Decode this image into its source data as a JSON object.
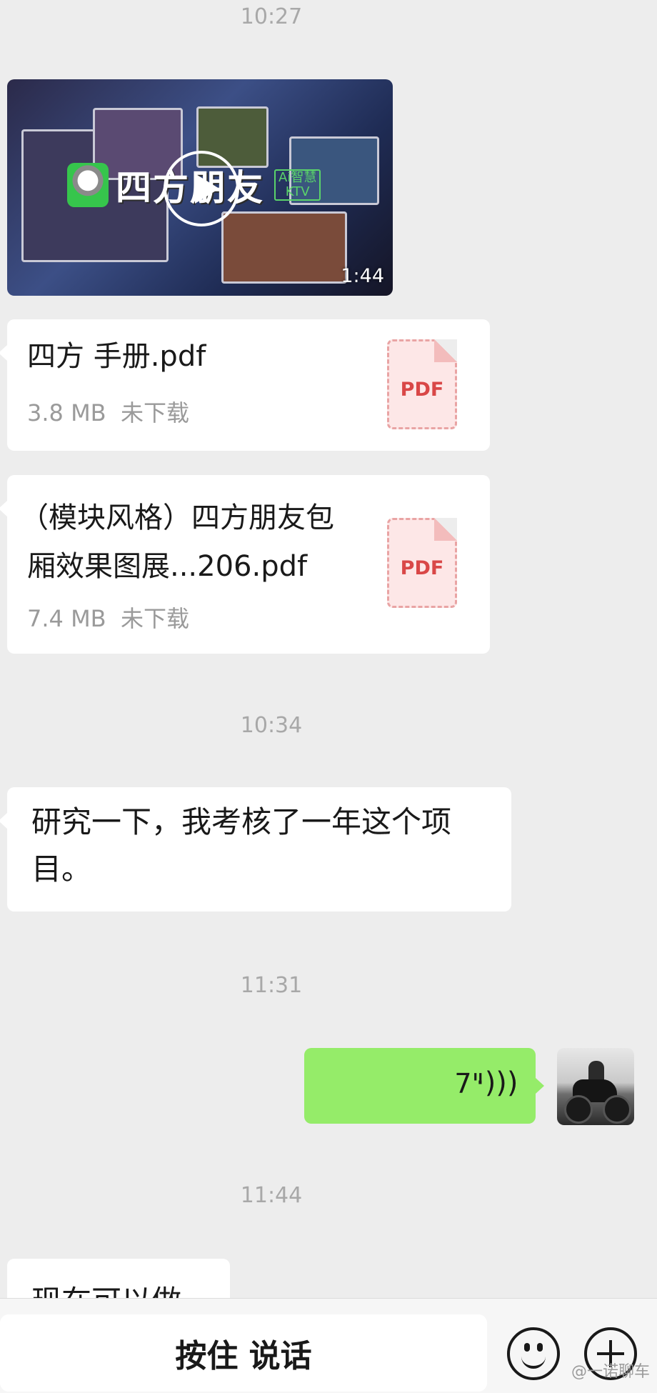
{
  "timestamps": [
    "10:27",
    "10:34",
    "11:31",
    "11:44"
  ],
  "video": {
    "brand_text": "四方朋友",
    "badge_top": "Ai智慧",
    "badge_bottom": "KTV",
    "duration": "1:44"
  },
  "files": [
    {
      "name": "四方 手册.pdf",
      "size": "3.8 MB",
      "status": "未下载",
      "type_label": "PDF"
    },
    {
      "name_line1": "（模块风格）四方朋友包",
      "name_line2": "厢效果图展...206.pdf",
      "size": "7.4 MB",
      "status": "未下载",
      "type_label": "PDF"
    }
  ],
  "messages": {
    "text1_line1": "研究一下，我考核了一年这个项",
    "text1_line2": "目。",
    "voice_duration": "7\"",
    "voice_icon": "(((·",
    "partial_text": "现在可以做"
  },
  "bottom_bar": {
    "hold_to_talk": "按住 说话",
    "emoji_icon": "emoji-icon",
    "plus_icon": "plus-icon"
  },
  "watermark": "@一诺聊车"
}
